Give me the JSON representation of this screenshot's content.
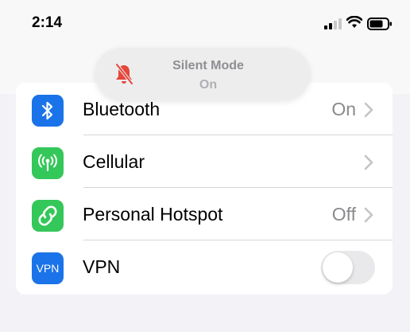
{
  "status_bar": {
    "time": "2:14"
  },
  "banner": {
    "title": "Silent Mode",
    "subtitle": "On",
    "icon": "bell-slash-icon"
  },
  "settings": {
    "rows": [
      {
        "label": "Bluetooth",
        "value": "On",
        "icon": "bluetooth-icon",
        "icon_color": "#1a73e8"
      },
      {
        "label": "Cellular",
        "value": "",
        "icon": "cellular-antenna-icon",
        "icon_color": "#34c759"
      },
      {
        "label": "Personal Hotspot",
        "value": "Off",
        "icon": "hotspot-link-icon",
        "icon_color": "#34c759"
      },
      {
        "label": "VPN",
        "value": "",
        "icon": "vpn-icon",
        "icon_color": "#1a73e8",
        "icon_text": "VPN",
        "toggle": false
      }
    ]
  }
}
